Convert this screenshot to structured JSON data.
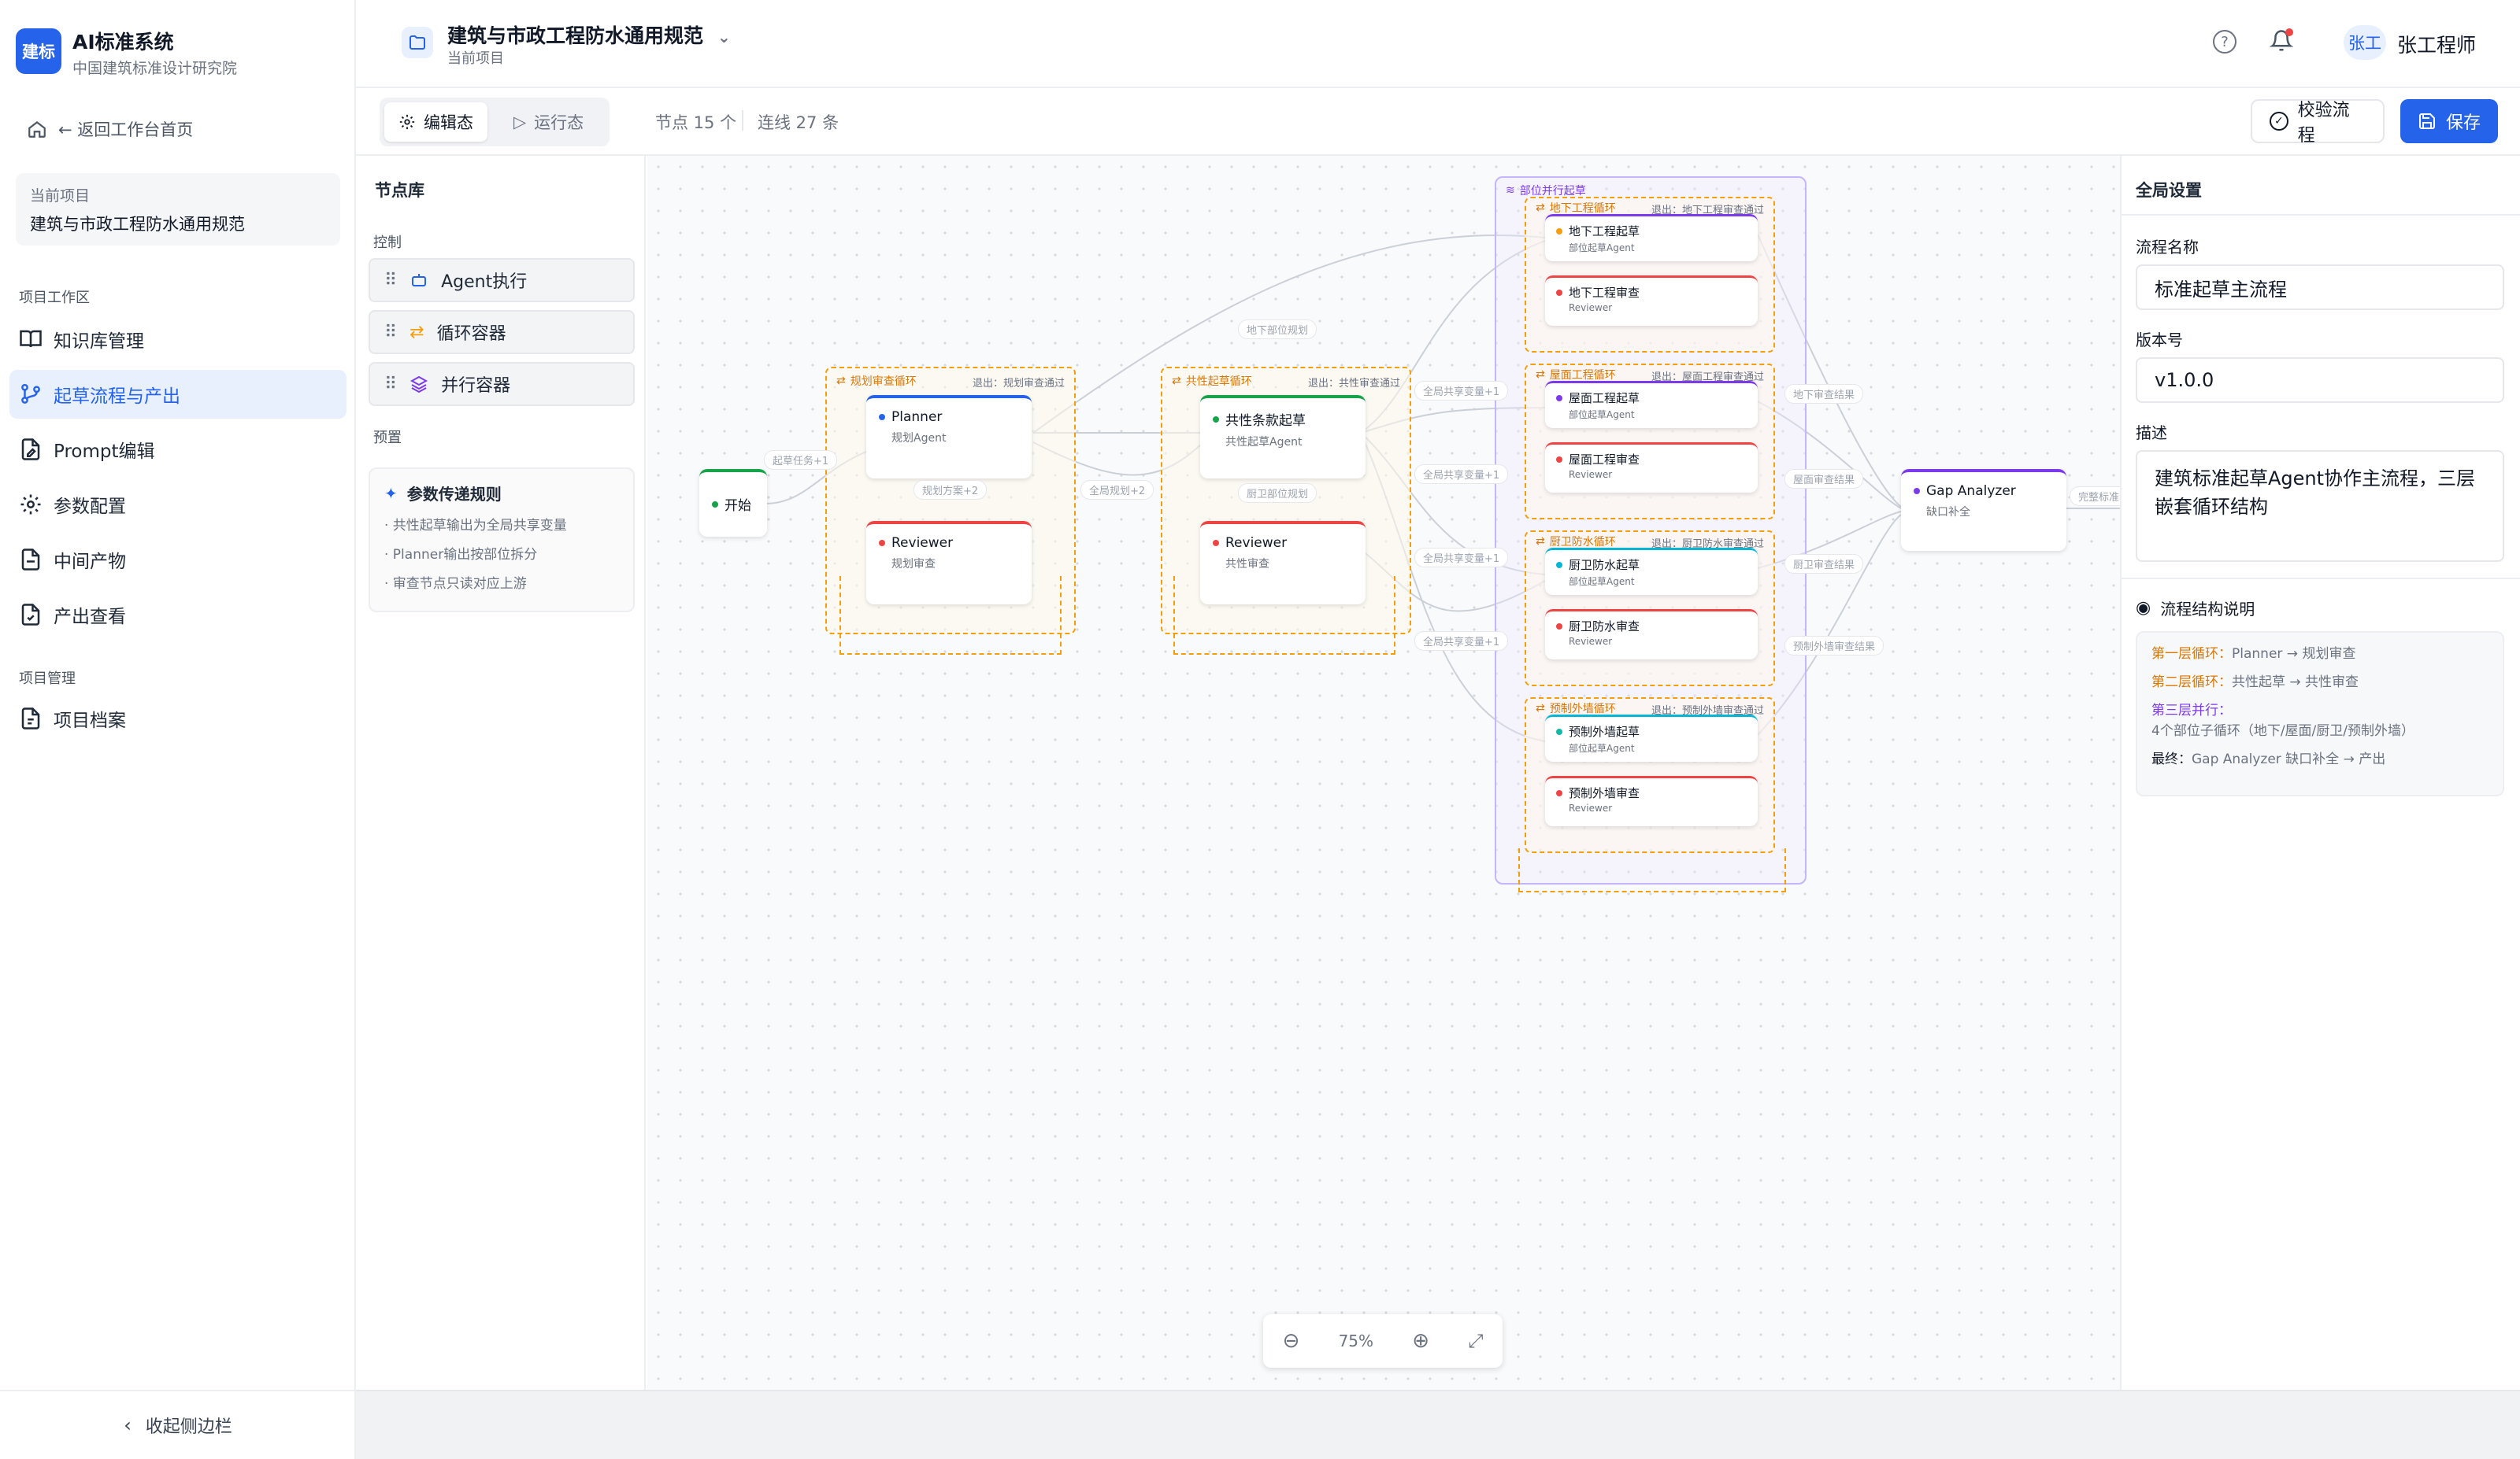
{
  "sidebar": {
    "logo": "建标",
    "system_name": "AI标准系统",
    "org": "中国建筑标准设计研究院",
    "back": "← 返回工作台首页",
    "current_label": "当前项目",
    "current_value": "建筑与市政工程防水通用规范",
    "section1": "项目工作区",
    "section2": "项目管理",
    "items": [
      {
        "label": "知识库管理",
        "icon": "book-icon"
      },
      {
        "label": "起草流程与产出",
        "icon": "flow-icon"
      },
      {
        "label": "Prompt编辑",
        "icon": "file-edit-icon"
      },
      {
        "label": "参数配置",
        "icon": "gear-icon"
      },
      {
        "label": "中间产物",
        "icon": "file-icon"
      },
      {
        "label": "产出查看",
        "icon": "file-check-icon"
      }
    ],
    "manage_items": [
      {
        "label": "项目档案",
        "icon": "archive-icon"
      }
    ],
    "collapse": "收起侧边栏"
  },
  "header": {
    "project": "建筑与市政工程防水通用规范",
    "project_sub": "当前项目",
    "user_badge": "张工",
    "user_name": "张工程师"
  },
  "toolbar": {
    "edit": "编辑态",
    "run": "运行态",
    "nodes": "节点 15 个",
    "edges": "连线 27 条",
    "validate": "校验流程",
    "save": "保存"
  },
  "library": {
    "title": "节点库",
    "control": "控制",
    "items": [
      "Agent执行",
      "循环容器",
      "并行容器"
    ],
    "preset": "预置",
    "rules_title": "参数传递规则",
    "rules": [
      "· 共性起草输出为全局共享变量",
      "· Planner输出按部位拆分",
      "· 审查节点只读对应上游"
    ]
  },
  "canvas": {
    "start": "开始",
    "loop1": {
      "title": "规划审查循环",
      "exit": "退出：规划审查通过"
    },
    "loop2": {
      "title": "共性起草循环",
      "exit": "退出：共性审查通过"
    },
    "parallel": "部位并行起草",
    "planner": {
      "name": "Planner",
      "sub": "规划Agent"
    },
    "reviewer1": {
      "name": "Reviewer",
      "sub": "规划审查"
    },
    "common": {
      "name": "共性条款起草",
      "sub": "共性起草Agent"
    },
    "reviewer2": {
      "name": "Reviewer",
      "sub": "共性审查"
    },
    "sub_loops": [
      {
        "title": "地下工程循环",
        "exit": "退出：地下工程审查通过",
        "draft": "地下工程起草",
        "draft_sub": "部位起草Agent",
        "review": "地下工程审查",
        "review_sub": "Reviewer"
      },
      {
        "title": "屋面工程循环",
        "exit": "退出：屋面工程审查通过",
        "draft": "屋面工程起草",
        "draft_sub": "部位起草Agent",
        "review": "屋面工程审查",
        "review_sub": "Reviewer"
      },
      {
        "title": "厨卫防水循环",
        "exit": "退出：厨卫防水审查通过",
        "draft": "厨卫防水起草",
        "draft_sub": "部位起草Agent",
        "review": "厨卫防水审查",
        "review_sub": "Reviewer"
      },
      {
        "title": "预制外墙循环",
        "exit": "退出：预制外墙审查通过",
        "draft": "预制外墙起草",
        "draft_sub": "部位起草Agent",
        "review": "预制外墙审查",
        "review_sub": "Reviewer"
      }
    ],
    "gap": {
      "name": "Gap Analyzer",
      "sub": "缺口补全"
    },
    "edges": {
      "task": "起草任务+1",
      "plan": "规划方案+2",
      "full": "全局规划+2",
      "under": "地下部位规划",
      "kitchen": "厨卫部位规划",
      "share": "全局共享变量+1",
      "r1": "地下审查结果",
      "r2": "屋面审查结果",
      "r3": "厨卫审查结果",
      "r4": "预制外墙审查结果",
      "out": "完整标准草"
    },
    "zoom": "75%"
  },
  "settings": {
    "title": "全局设置",
    "name_label": "流程名称",
    "name_value": "标准起草主流程",
    "ver_label": "版本号",
    "ver_value": "v1.0.0",
    "desc_label": "描述",
    "desc_value": "建筑标准起草Agent协作主流程，三层嵌套循环结构",
    "struct_title": "流程结构说明",
    "struct": [
      {
        "k": "第一层循环：",
        "v": "Planner → 规划审查",
        "color": "#d97706"
      },
      {
        "k": "第二层循环：",
        "v": "共性起草 → 共性审查",
        "color": "#d97706"
      },
      {
        "k": "第三层并行：",
        "v": "4个部位子循环（地下/屋面/厨卫/预制外墙）",
        "color": "#7c3aed"
      },
      {
        "k": "最终：",
        "v": "Gap Analyzer 缺口补全 → 产出",
        "color": "#111827"
      }
    ]
  },
  "colors": {
    "accent": "#2563eb",
    "loop": "#f59e0b",
    "parallel": "#a78bfa",
    "green": "#16a34a",
    "red": "#ef4444",
    "teal": "#06b6d4"
  }
}
